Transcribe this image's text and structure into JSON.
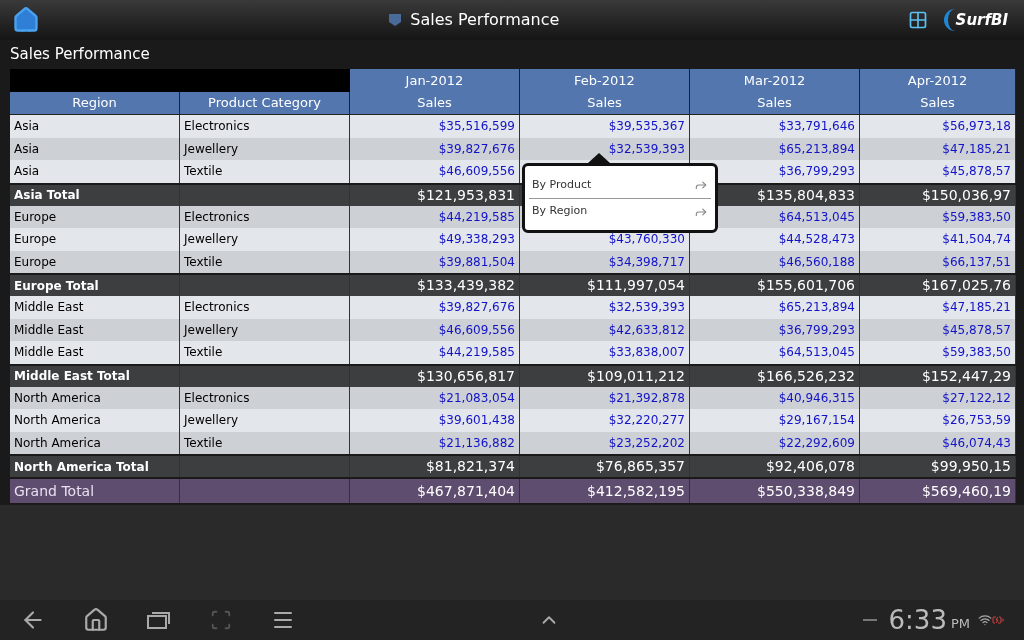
{
  "action_bar": {
    "title": "Sales Performance",
    "logo": "SurfBI"
  },
  "report": {
    "title": "Sales Performance"
  },
  "table": {
    "months": [
      {
        "label": "Jan-2012",
        "measure": "Sales"
      },
      {
        "label": "Feb-2012",
        "measure": "Sales"
      },
      {
        "label": "Mar-2012",
        "measure": "Sales"
      },
      {
        "label": "Apr-2012",
        "measure": "Sales"
      }
    ],
    "row_headers": [
      "Region",
      "Product Category"
    ],
    "rows": [
      {
        "kind": "detail",
        "region": "Asia",
        "category": "Electronics",
        "values": [
          "$35,516,599",
          "$39,535,367",
          "$33,791,646",
          "$56,973,18"
        ]
      },
      {
        "kind": "detail",
        "region": "Asia",
        "category": "Jewellery",
        "values": [
          "$39,827,676",
          "$32,539,393",
          "$65,213,894",
          "$47,185,21"
        ]
      },
      {
        "kind": "detail",
        "region": "Asia",
        "category": "Textile",
        "values": [
          "$46,609,556",
          {
            "covered": true
          },
          "$36,799,293",
          "$45,878,57"
        ]
      },
      {
        "kind": "total",
        "region": "Asia Total",
        "values": [
          "$121,953,831",
          {
            "covered": true
          },
          "$135,804,833",
          "$150,036,97"
        ]
      },
      {
        "kind": "detail",
        "region": "Europe",
        "category": "Electronics",
        "values": [
          "$44,219,585",
          {
            "covered": true
          },
          "$64,513,045",
          "$59,383,50"
        ]
      },
      {
        "kind": "detail",
        "region": "Europe",
        "category": "Jewellery",
        "values": [
          "$49,338,293",
          "$43,760,330",
          "$44,528,473",
          "$41,504,74"
        ]
      },
      {
        "kind": "detail",
        "region": "Europe",
        "category": "Textile",
        "values": [
          "$39,881,504",
          "$34,398,717",
          "$46,560,188",
          "$66,137,51"
        ]
      },
      {
        "kind": "total",
        "region": "Europe Total",
        "values": [
          "$133,439,382",
          "$111,997,054",
          "$155,601,706",
          "$167,025,76"
        ]
      },
      {
        "kind": "detail",
        "region": "Middle East",
        "category": "Electronics",
        "values": [
          "$39,827,676",
          "$32,539,393",
          "$65,213,894",
          "$47,185,21"
        ]
      },
      {
        "kind": "detail",
        "region": "Middle East",
        "category": "Jewellery",
        "values": [
          "$46,609,556",
          "$42,633,812",
          "$36,799,293",
          "$45,878,57"
        ]
      },
      {
        "kind": "detail",
        "region": "Middle East",
        "category": "Textile",
        "values": [
          "$44,219,585",
          "$33,838,007",
          "$64,513,045",
          "$59,383,50"
        ]
      },
      {
        "kind": "total",
        "region": "Middle East Total",
        "values": [
          "$130,656,817",
          "$109,011,212",
          "$166,526,232",
          "$152,447,29"
        ]
      },
      {
        "kind": "detail",
        "region": "North America",
        "category": "Electronics",
        "values": [
          "$21,083,054",
          "$21,392,878",
          "$40,946,315",
          "$27,122,12"
        ]
      },
      {
        "kind": "detail",
        "region": "North America",
        "category": "Jewellery",
        "values": [
          "$39,601,438",
          "$32,220,277",
          "$29,167,154",
          "$26,753,59"
        ]
      },
      {
        "kind": "detail",
        "region": "North America",
        "category": "Textile",
        "values": [
          "$21,136,882",
          "$23,252,202",
          "$22,292,609",
          "$46,074,43"
        ]
      },
      {
        "kind": "total",
        "region": "North America Total",
        "values": [
          "$81,821,374",
          "$76,865,357",
          "$92,406,078",
          "$99,950,15"
        ]
      },
      {
        "kind": "grand",
        "region": "Grand Total",
        "values": [
          "$467,871,404",
          "$412,582,195",
          "$550,338,849",
          "$569,460,19"
        ]
      }
    ]
  },
  "popup_menu": {
    "items": [
      "By Product",
      "By Region"
    ]
  },
  "system_bar": {
    "time": "6:33",
    "meridiem": "PM"
  }
}
